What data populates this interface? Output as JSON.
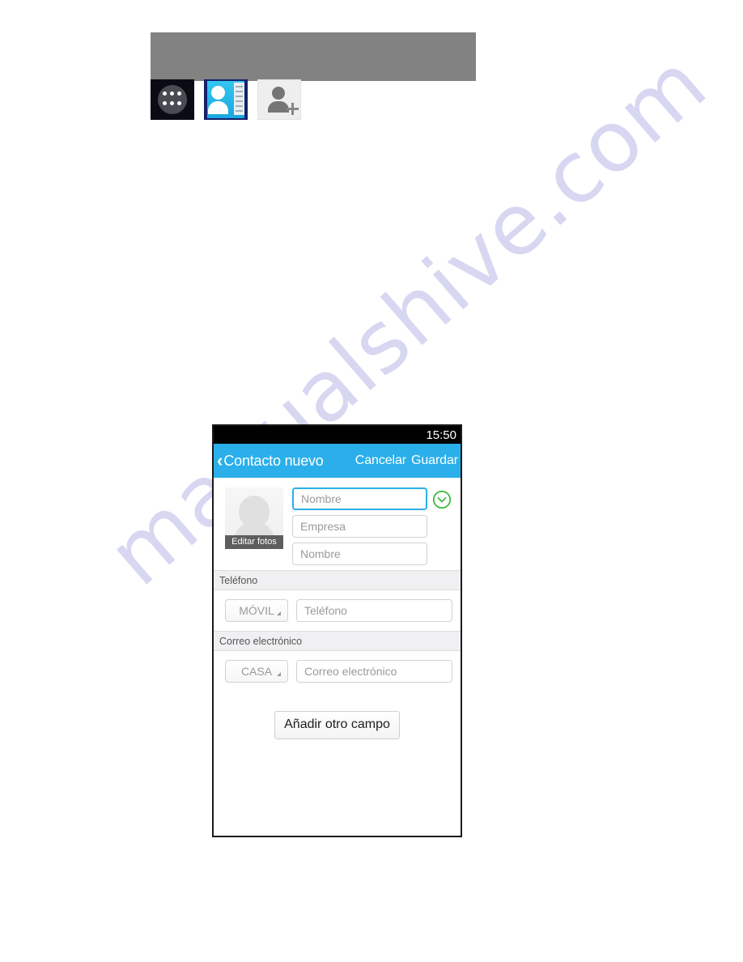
{
  "watermark": {
    "text": "manualshive.com",
    "color": "#c9c9ee"
  },
  "desktop": {
    "taskbar_color": "#828282",
    "icons": [
      {
        "name": "app-drawer-icon",
        "label": ""
      },
      {
        "name": "contacts-app-icon",
        "label": ""
      },
      {
        "name": "add-contact-icon",
        "label": ""
      }
    ]
  },
  "phone": {
    "status_bar": {
      "time": "15:50",
      "background": "#000000"
    },
    "action_bar": {
      "back_chevron": "‹",
      "title": "Contacto nuevo",
      "cancel_label": "Cancelar",
      "save_label": "Guardar",
      "background": "#2aafea"
    },
    "photo": {
      "edit_label": "Editar fotos"
    },
    "expand_icon_color": "#3fb83f",
    "name_fields": [
      {
        "name": "name-input",
        "placeholder": "Nombre",
        "value": "",
        "focused": true
      },
      {
        "name": "company-input",
        "placeholder": "Empresa",
        "value": "",
        "focused": false
      },
      {
        "name": "given-name-input",
        "placeholder": "Nombre",
        "value": "",
        "focused": false
      }
    ],
    "sections": [
      {
        "header": "Teléfono",
        "type_label": "MÓVIL",
        "field_placeholder": "Teléfono",
        "field_value": ""
      },
      {
        "header": "Correo electrónico",
        "type_label": "CASA",
        "field_placeholder": "Correo electrónico",
        "field_value": ""
      }
    ],
    "add_field_label": "Añadir otro campo"
  }
}
